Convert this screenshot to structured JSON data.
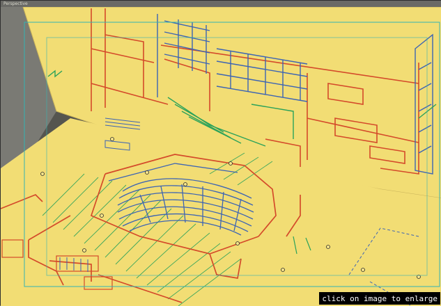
{
  "viewport": {
    "label": "Perspective",
    "background_color": "#55554f",
    "plane_color": "#f2dd74"
  },
  "colors": {
    "wall_red": "#d44a2a",
    "wall_blue": "#3c64b4",
    "wall_green": "#2aa25a",
    "frame_cyan": "#34b4b4"
  },
  "caption": {
    "text": "click on image to enlarge"
  }
}
